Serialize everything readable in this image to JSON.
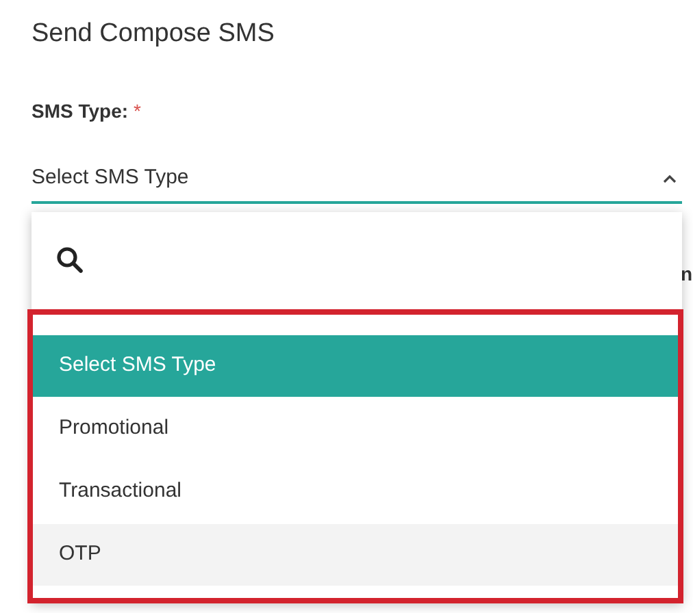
{
  "title": "Send Compose SMS",
  "field": {
    "label": "SMS Type:",
    "required_mark": "*",
    "value": "Select SMS Type",
    "expanded": true
  },
  "dropdown": {
    "options": [
      {
        "label": "Select SMS Type",
        "selected": true,
        "hovered": false
      },
      {
        "label": "Promotional",
        "selected": false,
        "hovered": false
      },
      {
        "label": "Transactional",
        "selected": false,
        "hovered": false
      },
      {
        "label": "OTP",
        "selected": false,
        "hovered": true
      }
    ]
  },
  "highlight": {
    "kind": "annotation-frame"
  },
  "background_text": "n"
}
